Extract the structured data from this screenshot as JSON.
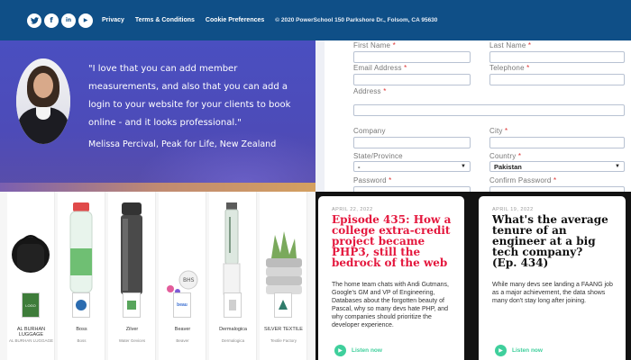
{
  "footer": {
    "social_icons": [
      {
        "name": "twitter-icon",
        "glyph": "🐦"
      },
      {
        "name": "facebook-icon",
        "glyph": "f"
      },
      {
        "name": "linkedin-icon",
        "glyph": "in"
      },
      {
        "name": "youtube-icon",
        "glyph": "▶"
      }
    ],
    "links": [
      "Privacy",
      "Terms & Conditions",
      "Cookie Preferences"
    ],
    "copyright": "© 2020 PowerSchool 150 Parkshore Dr., Folsom, CA 95630",
    "bg_color": "#0f4f87"
  },
  "testimonial": {
    "quote": "\"I love that you can add member measurements, and also that you can add a login to your website for your clients to book online - and it looks professional.\"",
    "author": "Melissa Percival, Peak for Life, New Zealand"
  },
  "form": {
    "fields": [
      {
        "label": "First Name",
        "required": "*"
      },
      {
        "label": "Last Name",
        "required": "*"
      },
      {
        "label": "Email Address",
        "required": "*"
      },
      {
        "label": "Telephone",
        "required": "*"
      },
      {
        "label": "Address",
        "required": "*"
      },
      {
        "label": "Company",
        "required": ""
      },
      {
        "label": "City",
        "required": "*"
      },
      {
        "label": "State/Province",
        "required": ""
      },
      {
        "label": "Country",
        "required": "*"
      },
      {
        "label": "Password",
        "required": "*"
      },
      {
        "label": "Confirm Password",
        "required": "*"
      }
    ],
    "state_value": "-",
    "country_value": "Pakistan"
  },
  "products": [
    {
      "name": "AL BURHAN LUGGAGE",
      "sub": "AL BURHAN LUGGAGE",
      "logo": "LOGO"
    },
    {
      "name": "Boss",
      "sub": "Boss",
      "logo": ""
    },
    {
      "name": "Zilver",
      "sub": "Water Gevices",
      "logo": ""
    },
    {
      "name": "Beaver",
      "sub": "Beaver",
      "logo": "beau"
    },
    {
      "name": "Dermalogica",
      "sub": "Dermalogica",
      "logo": ""
    },
    {
      "name": "SILVER TEXTILE",
      "sub": "Textile Factory",
      "logo": ""
    }
  ],
  "podcasts": [
    {
      "date": "APRIL 22, 2022",
      "title": "Episode 435: How a college extra-credit project became PHP3, still the bedrock of the web",
      "description": "The home team chats with Andi Gutmans, Google's GM and VP of Engineering, Databases about the forgotten beauty of Pascal, why so many devs hate PHP, and why companies should prioritize the developer experience.",
      "listen": "Listen now",
      "title_color": "#e4173d"
    },
    {
      "date": "APRIL 19, 2022",
      "title": "What's the average tenure of an engineer at a big tech company? (Ep. 434)",
      "description": "While many devs see landing a FAANG job as a major achievement, the data shows many don't stay long after joining.",
      "listen": "Listen now",
      "title_color": "#111111"
    }
  ],
  "colors": {
    "accent_green": "#3fcf9c",
    "testimonial_bg": "#4a4fc0"
  }
}
